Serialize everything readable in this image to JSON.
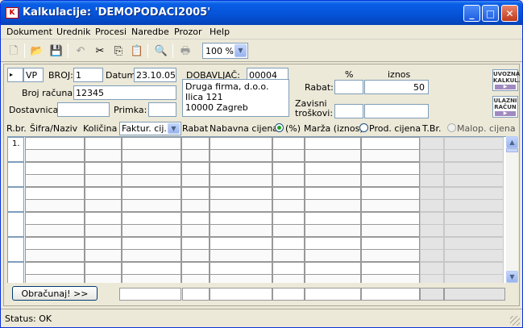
{
  "window": {
    "title": "Kalkulacije: 'DEMOPODACI2005'",
    "app_icon_glyph": "K"
  },
  "title_buttons": {
    "minimize": "_",
    "maximize": "□",
    "close": "✕"
  },
  "menu": [
    "Dokument",
    "Urednik",
    "Procesi",
    "Naredbe",
    "Prozor",
    "Help"
  ],
  "toolbar": {
    "icons": [
      "new-file-icon",
      "open-folder-icon",
      "save-disk-icon",
      "undo-icon",
      "cut-scissors-icon",
      "copy-icon",
      "paste-icon",
      "find-magnifier-icon",
      "print-icon"
    ],
    "glyphs": {
      "new": "🗋",
      "open": "📂",
      "save": "💾",
      "undo": "↶",
      "cut": "✂",
      "copy": "⎘",
      "paste": "📋",
      "find": "🔍",
      "print": "🖶",
      "dropdown": "▼"
    },
    "zoom": "100 %"
  },
  "form": {
    "row_marker_glyph": "▸",
    "doc_type": "VP",
    "broj_label": "BROJ:",
    "broj": "1",
    "datum_label": "Datum:",
    "datum": "23.10.05",
    "dobavljac_label": "DOBAVLJAČ:",
    "dobavljac_code": "00004",
    "supplier_lines": [
      "Druga firma, d.o.o.",
      "Ilica 121",
      "10000 Zagreb"
    ],
    "broj_racuna_label": "Broj računa:",
    "broj_racuna": "12345",
    "dostavnica_label": "Dostavnica:",
    "dostavnica": "",
    "primka_label": "Primka:",
    "primka": "",
    "pct_header": "%",
    "iznos_header": "iznos",
    "rabat_label": "Rabat:",
    "rabat_pct": "",
    "rabat_iznos": "50",
    "zavisni_label1": "Zavisni",
    "zavisni_label2": "troškovi:",
    "zavisni_pct": "",
    "zavisni_iznos": ""
  },
  "side_buttons": [
    {
      "line1": "UVOZNA",
      "line2": "KALKUL.",
      "arrow": "▶"
    },
    {
      "line1": "ULAZNI",
      "line2": "RAČUN",
      "arrow": "▶"
    }
  ],
  "columns": {
    "rbr": "R.br.",
    "sifra": "Šifra/Naziv",
    "kolicina": "Količina",
    "price_select": "Faktur. cij.",
    "rabat": "Rabat",
    "nabavna": "Nabavna cijena",
    "radio_pct": "(%)",
    "marza": "Marža (iznos)",
    "prod": "Prod. cijena",
    "tbr": "T.Br.",
    "malop": "Malop. cijena"
  },
  "rows": [
    {
      "num": "1."
    },
    {
      "num": ""
    },
    {
      "num": ""
    },
    {
      "num": ""
    },
    {
      "num": ""
    },
    {
      "num": ""
    }
  ],
  "scroll_glyphs": {
    "up": "▲",
    "down": "▼"
  },
  "calc_button": "Obračunaj! >>",
  "status": "Status: OK"
}
